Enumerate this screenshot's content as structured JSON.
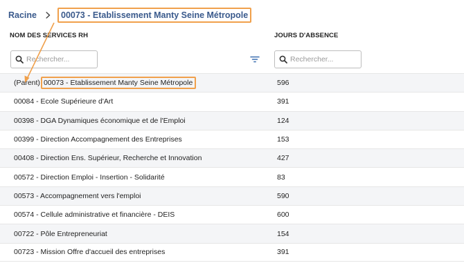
{
  "breadcrumb": {
    "root": "Racine",
    "current": "00073 - Etablissement Manty Seine Métropole"
  },
  "columns": {
    "name": "NOM DES SERVICES RH",
    "days": "JOURS D'ABSENCE"
  },
  "search": {
    "placeholder": "Rechercher..."
  },
  "parent_prefix": "(Parent)",
  "rows": [
    {
      "name": "00073 - Etablissement Manty Seine Métropole",
      "days": "596"
    },
    {
      "name": "00084 - Ecole Supérieure d'Art",
      "days": "391"
    },
    {
      "name": "00398 - DGA Dynamiques économique et de l'Emploi",
      "days": "124"
    },
    {
      "name": "00399 - Direction Accompagnement des Entreprises",
      "days": "153"
    },
    {
      "name": "00408 - Direction Ens. Supérieur, Recherche et Innovation",
      "days": "427"
    },
    {
      "name": "00572 - Direction Emploi - Insertion - Solidarité",
      "days": "83"
    },
    {
      "name": "00573 - Accompagnement vers l'emploi",
      "days": "590"
    },
    {
      "name": "00574 - Cellule administrative et financière - DEIS",
      "days": "600"
    },
    {
      "name": "00722 - Pôle Entrepreneuriat",
      "days": "154"
    },
    {
      "name": "00723 - Mission Offre d'accueil des entreprises",
      "days": "391"
    }
  ],
  "colors": {
    "breadcrumb_text": "#3a5a8c",
    "highlight": "#f0a04b",
    "row_alt": "#f4f5f7"
  }
}
